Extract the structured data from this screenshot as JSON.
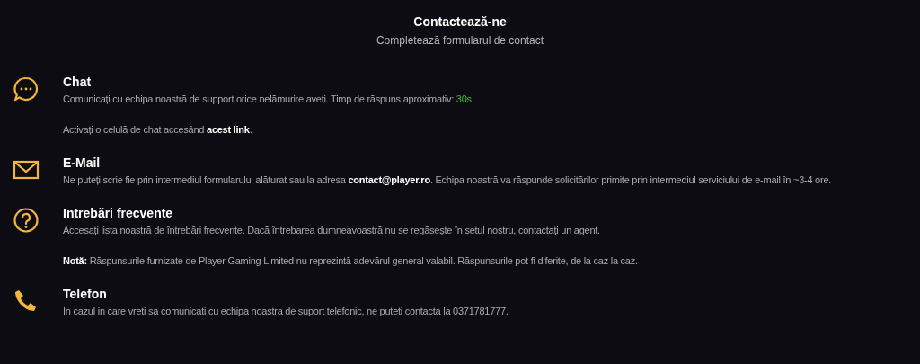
{
  "header": {
    "title": "Contactează-ne",
    "subtitle": "Completează formularul de contact"
  },
  "sections": [
    {
      "kind": "chat",
      "title": "Chat",
      "paragraphs": [
        [
          {
            "kind": "plain",
            "text": "Comunicați cu echipa noastră de support orice nelămurire aveți. Timp de răspuns aproximativ: "
          },
          {
            "kind": "accent",
            "text": "30s"
          },
          {
            "kind": "plain",
            "text": "."
          }
        ],
        [
          {
            "kind": "plain",
            "text": "Activați o celulă de chat accesând "
          },
          {
            "kind": "link",
            "text": "acest link"
          },
          {
            "kind": "plain",
            "text": "."
          }
        ]
      ]
    },
    {
      "kind": "mail",
      "title": "E-Mail",
      "paragraphs": [
        [
          {
            "kind": "plain",
            "text": "Ne puteți scrie fie prin intermediul formularului alăturat sau la adresa "
          },
          {
            "kind": "bold",
            "text": "contact@player.ro"
          },
          {
            "kind": "plain",
            "text": ". Echipa noastră va răspunde solicitărilor primite prin intermediul serviciului de e-mail în ~3-4 ore."
          }
        ]
      ]
    },
    {
      "kind": "question",
      "title": "Intrebări frecvente",
      "paragraphs": [
        [
          {
            "kind": "plain",
            "text": "Accesați lista noastră de întrebări frecvente. Dacă întrebarea dumneavoastră nu se regăsește în setul nostru, contactați un agent."
          }
        ],
        [
          {
            "kind": "bold",
            "text": "Notă:"
          },
          {
            "kind": "plain",
            "text": " Răspunsurile furnizate de Player Gaming Limited nu reprezintă adevărul general valabil. Răspunsurile pot fi diferite, de la caz la caz."
          }
        ]
      ]
    },
    {
      "kind": "phone",
      "title": "Telefon",
      "paragraphs": [
        [
          {
            "kind": "plain",
            "text": "In cazul in care vreti sa comunicati cu echipa noastra de suport telefonic, ne puteti contacta la 0371781777."
          }
        ]
      ]
    }
  ]
}
